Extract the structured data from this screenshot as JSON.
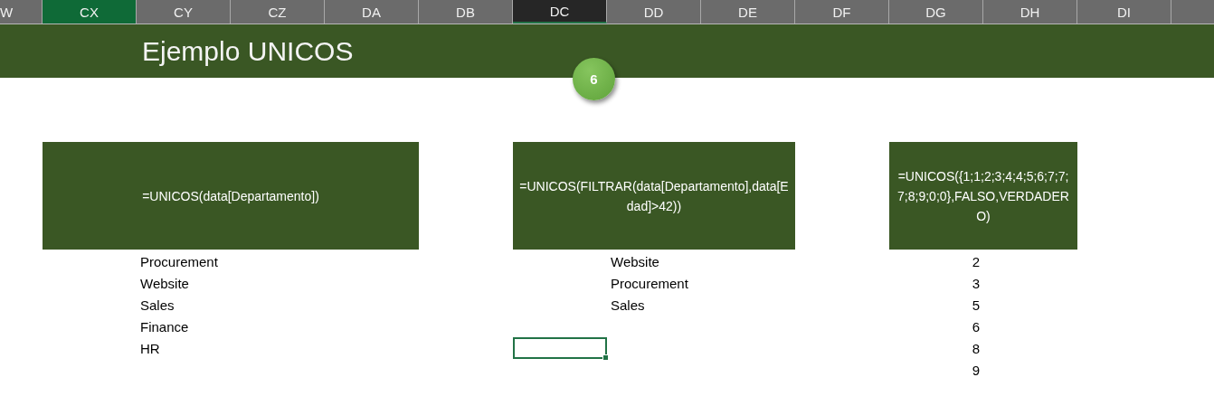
{
  "column_headers": [
    {
      "label": "W",
      "kind": "normal"
    },
    {
      "label": "CX",
      "kind": "highlighted"
    },
    {
      "label": "CY",
      "kind": "normal"
    },
    {
      "label": "CZ",
      "kind": "normal"
    },
    {
      "label": "DA",
      "kind": "normal"
    },
    {
      "label": "DB",
      "kind": "normal"
    },
    {
      "label": "DC",
      "kind": "active"
    },
    {
      "label": "DD",
      "kind": "normal"
    },
    {
      "label": "DE",
      "kind": "normal"
    },
    {
      "label": "DF",
      "kind": "normal"
    },
    {
      "label": "DG",
      "kind": "normal"
    },
    {
      "label": "DH",
      "kind": "normal"
    },
    {
      "label": "DI",
      "kind": "normal"
    }
  ],
  "banner": {
    "title": "Ejemplo UNICOS"
  },
  "step_badge": {
    "label": "6"
  },
  "examples": [
    {
      "formula": "=UNICOS(data[Departamento])",
      "kind": "text",
      "results": [
        "Procurement",
        "Website",
        "Sales",
        "Finance",
        "HR"
      ]
    },
    {
      "formula": "=UNICOS(FILTRAR(data[Departamento],data[Edad]>42))",
      "kind": "text",
      "results": [
        "Website",
        "Procurement",
        "Sales"
      ]
    },
    {
      "formula": "=UNICOS({1;1;2;3;4;4;5;6;7;7;7;8;9;0;0},FALSO,VERDADERO)",
      "kind": "number",
      "results": [
        "2",
        "3",
        "5",
        "6",
        "8",
        "9"
      ]
    }
  ],
  "active_cell": {
    "selected": true
  }
}
